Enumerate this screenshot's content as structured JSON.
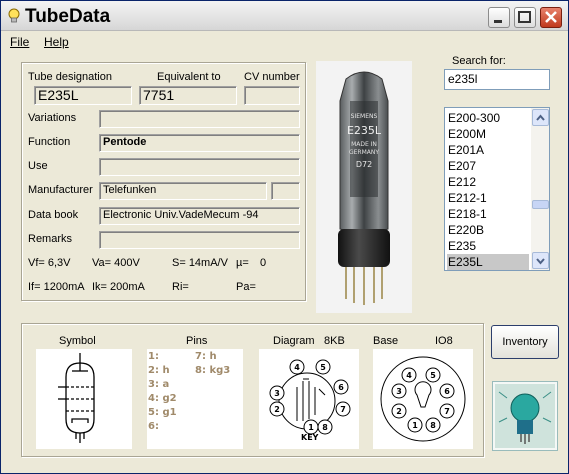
{
  "app": {
    "title": "TubeData"
  },
  "menu": {
    "file": "File",
    "help": "Help"
  },
  "info": {
    "tube_designation_label": "Tube designation",
    "equivalent_label": "Equivalent to",
    "cv_label": "CV number",
    "tube_designation": "E235L",
    "equivalent": "7751",
    "cv_number": "",
    "variations_label": "Variations",
    "variations": "",
    "function_label": "Function",
    "function": "Pentode",
    "use_label": "Use",
    "use": "",
    "manufacturer_label": "Manufacturer",
    "manufacturer": "Telefunken",
    "manufacturer_extra": "",
    "databook_label": "Data book",
    "databook": "Electronic Univ.VadeMecum -94",
    "remarks_label": "Remarks",
    "remarks": "",
    "params_row1": [
      "Vf= 6,3V",
      "Va= 400V",
      "S= 14mA/V",
      "µ=",
      "0"
    ],
    "params_row2": [
      "If= 1200mA",
      "Ik= 200mA",
      "Ri=",
      "Pa="
    ]
  },
  "tube_print": {
    "brand": "SIEMENS",
    "type": "E235L",
    "made_in": "MADE IN",
    "country": "GERMANY",
    "code": "D72"
  },
  "search": {
    "label": "Search for:",
    "value": "e235l"
  },
  "tube_list": {
    "items": [
      "E200-300",
      "E200M",
      "E201A",
      "E207",
      "E212",
      "E212-1",
      "E218-1",
      "E220B",
      "E235",
      "E235L"
    ],
    "selected": "E235L"
  },
  "panels": {
    "symbol_label": "Symbol",
    "pins_label": "Pins",
    "diagram_label": "Diagram",
    "diagram_size": "8KB",
    "base_label": "Base",
    "base_code": "IO8",
    "pins_left": [
      "1:",
      "2: h",
      "3: a",
      "4: g2",
      "5: g1",
      "6:"
    ],
    "pins_right": [
      "7: h",
      "8: kg3"
    ],
    "diagram_pins": [
      "1",
      "2",
      "3",
      "4",
      "5",
      "6",
      "7",
      "8"
    ],
    "key_label": "KEY",
    "base_pins": [
      "1",
      "2",
      "3",
      "4",
      "5",
      "6",
      "7",
      "8"
    ]
  },
  "inventory_button": "Inventory",
  "colors": {
    "list_selected": "#c8c8c8",
    "window_bg": "#ece9d8",
    "title_close": "#c0391d",
    "pins_text": "#a08a6a"
  }
}
